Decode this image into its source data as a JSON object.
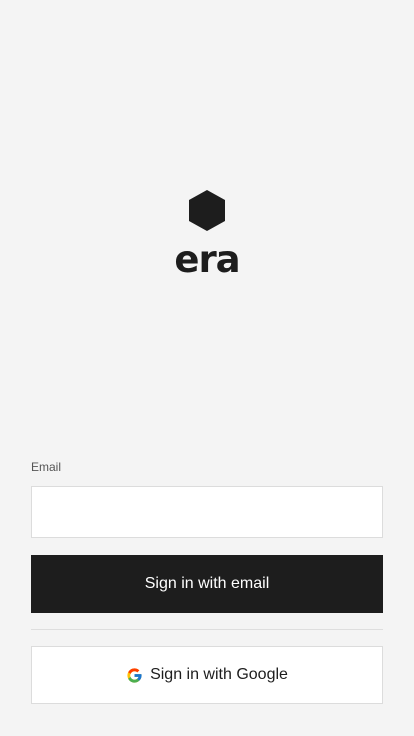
{
  "brand": {
    "name": "era",
    "logo_icon": "hexagon-icon",
    "logo_color": "#1d1d1d"
  },
  "form": {
    "email_label": "Email",
    "email_value": "",
    "email_placeholder": "",
    "email_button_label": "Sign in with email",
    "google_button_label": "Sign in with Google",
    "google_icon": "google-icon"
  },
  "colors": {
    "background": "#f4f4f4",
    "primary_button": "#1d1d1d",
    "primary_button_text": "#ffffff",
    "secondary_button": "#ffffff"
  }
}
